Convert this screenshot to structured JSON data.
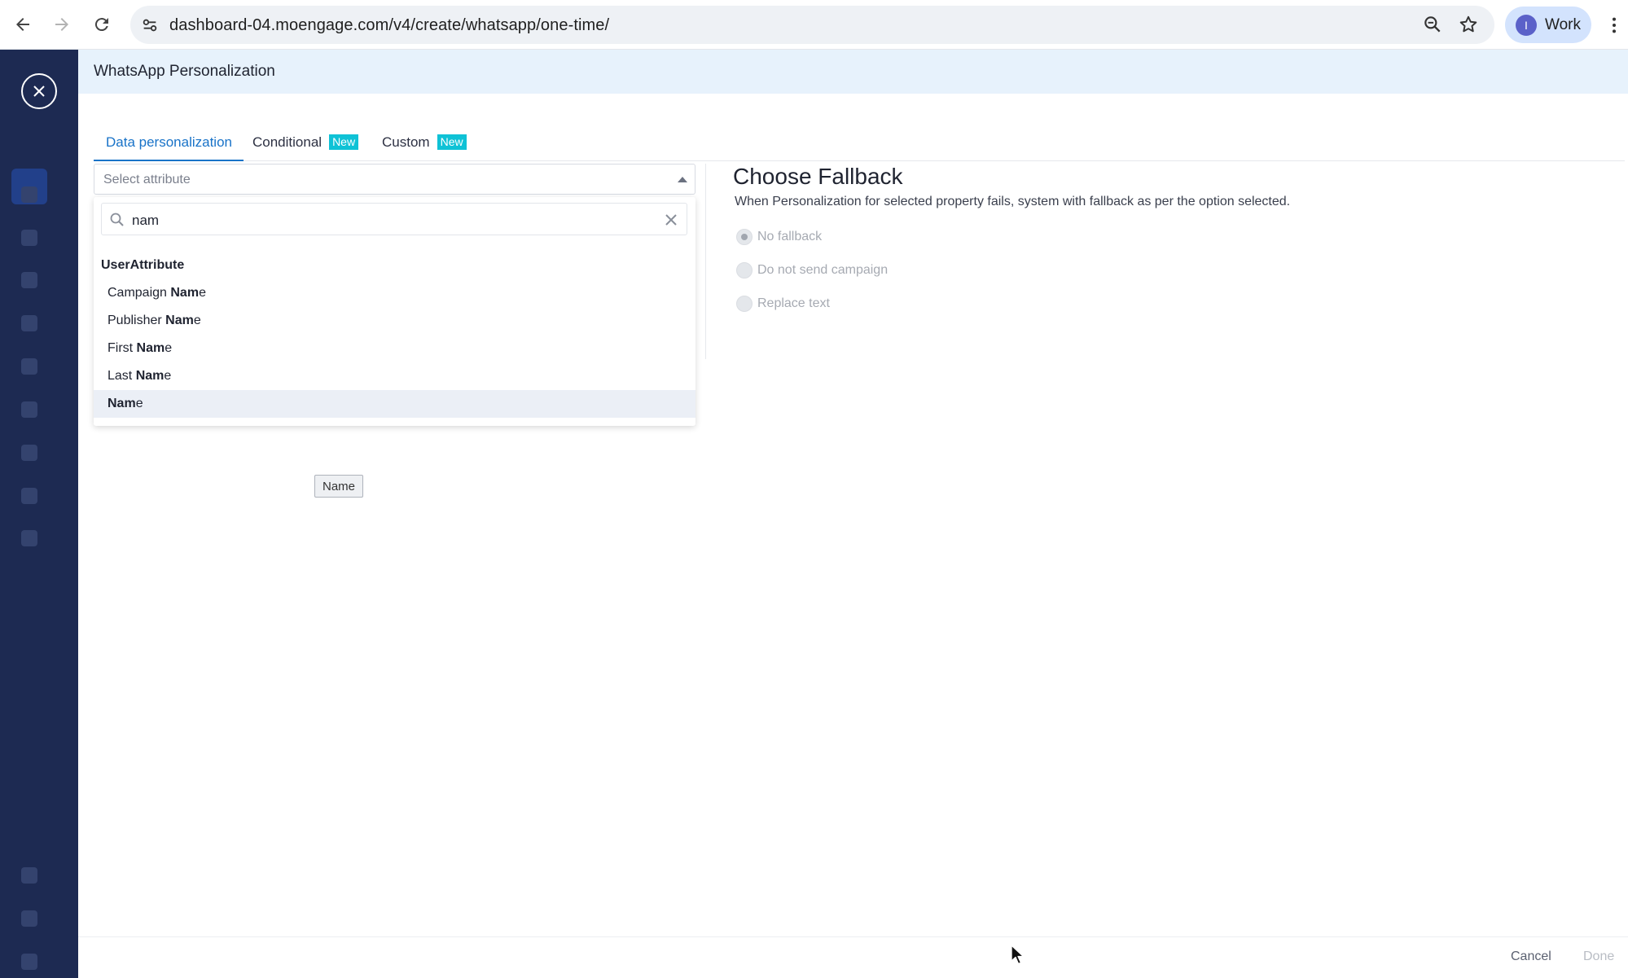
{
  "browser": {
    "url": "dashboard-04.moengage.com/v4/create/whatsapp/one-time/",
    "profile_initial": "I",
    "profile_label": "Work"
  },
  "modal": {
    "title": "WhatsApp Personalization",
    "tabs": [
      {
        "label": "Data personalization",
        "badge": ""
      },
      {
        "label": "Conditional",
        "badge": "New"
      },
      {
        "label": "Custom",
        "badge": "New"
      }
    ],
    "select": {
      "placeholder": "Select attribute"
    },
    "search": {
      "value": "nam"
    },
    "group_title": "UserAttribute",
    "options": [
      {
        "pre": "Campaign ",
        "match": "Nam",
        "post": "e"
      },
      {
        "pre": "Publisher ",
        "match": "Nam",
        "post": "e"
      },
      {
        "pre": "First ",
        "match": "Nam",
        "post": "e"
      },
      {
        "pre": "Last ",
        "match": "Nam",
        "post": "e"
      },
      {
        "pre": "",
        "match": "Nam",
        "post": "e"
      }
    ],
    "tooltip": "Name",
    "fallback": {
      "title": "Choose Fallback",
      "description": "When Personalization for selected property fails, system with fallback as per the option selected.",
      "options": [
        "No fallback",
        "Do not send campaign",
        "Replace text"
      ],
      "selected": "No fallback"
    },
    "footer": {
      "cancel": "Cancel",
      "done": "Done"
    }
  },
  "colors": {
    "accent": "#1973c8",
    "badge": "#0fc2d6",
    "rail": "#1d2a52",
    "header_bg": "#e7f2fc"
  }
}
